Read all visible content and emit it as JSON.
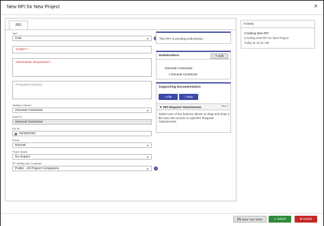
{
  "window": {
    "title": "New RFI for New Project",
    "close_glyph": "×"
  },
  "tabs": [
    {
      "label": "RFI"
    }
  ],
  "form": {
    "type": {
      "label": "Type",
      "value": "Civil"
    },
    "subject": {
      "placeholder": "Subject"
    },
    "information_requested": {
      "placeholder": "Information Requested"
    },
    "proposed_solution": {
      "placeholder": "Proposed Solution"
    },
    "initiating_contractor": {
      "label": "Initiating Contractor",
      "value": "General Contractor"
    },
    "submit_to": {
      "label": "Submit To",
      "value": "General Contractor"
    },
    "due_by": {
      "label": "Due By",
      "value": "02/26/2022"
    },
    "priority": {
      "label": "Priority",
      "value": "Normal"
    },
    "project_impacts": {
      "label": "Project Impacts",
      "value": "No Impact"
    },
    "visibility": {
      "label": "RFI Visibility Upon Completion",
      "value": "Public - All Project Companies"
    }
  },
  "pending": {
    "text": "This RFI is pending submission."
  },
  "stakeholders": {
    "title": "Stakeholders",
    "edit_label": "Edit",
    "group": "General Contractor",
    "member": "General Contractor"
  },
  "supporting_docs": {
    "title": "Supporting Documentation",
    "file_button": "File",
    "plan_button": "Plan",
    "attachments_title": "RFI Request Attachments",
    "files_count": "Files: 0",
    "hint": "Select one of the buttons above or drag and drop a file onto this screen to add RFI Request Attachments."
  },
  "activity": {
    "title": "Activity",
    "entry_title": "Creating New RFI",
    "entry_desc": "Creating new RFI for New Project",
    "entry_time": "Today at 10:41 AM"
  },
  "footer": {
    "save_label": "Save Your Work",
    "submit_label": "Submit",
    "cancel_label": "Cancel"
  },
  "colors": {
    "accent": "#3b4aa8",
    "submit": "#2e8b3a",
    "cancel": "#c62828",
    "required": "#d33333"
  },
  "icons": {
    "close": "close-icon",
    "info": "info-icon",
    "calendar": "calendar-icon",
    "edit": "pencil-icon",
    "file": "plus-icon",
    "plan": "plus-icon",
    "save": "save-icon",
    "submit": "check-icon",
    "cancel": "x-icon"
  }
}
